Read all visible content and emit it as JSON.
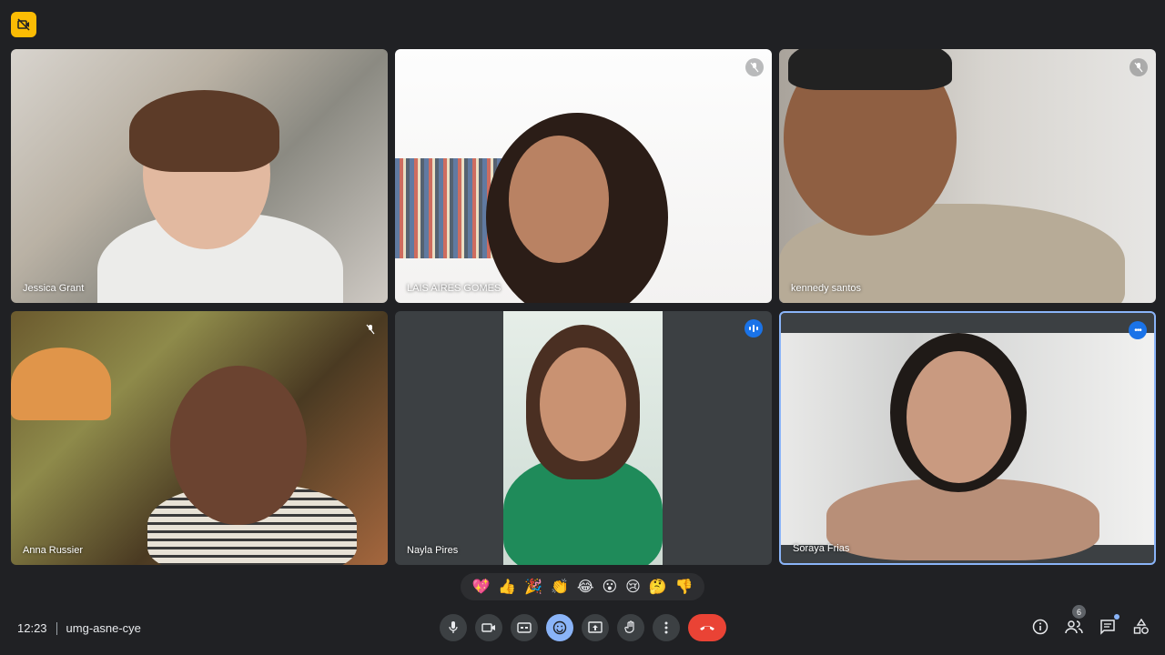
{
  "meeting": {
    "time": "12:23",
    "code": "umg-asne-cye"
  },
  "participants": [
    {
      "name": "Jessica Grant",
      "muted": false
    },
    {
      "name": "LAIS AIRES GOMES",
      "muted": true
    },
    {
      "name": "kennedy santos",
      "muted": true
    },
    {
      "name": "Anna Russier",
      "muted": true
    },
    {
      "name": "Nayla Pires",
      "muted": false,
      "speaking": true
    },
    {
      "name": "Soraya Frias",
      "muted": false,
      "pinned": true
    }
  ],
  "reactions": [
    "💖",
    "👍",
    "🎉",
    "👏",
    "😂",
    "😮",
    "😢",
    "🤔",
    "👎"
  ],
  "people_count": "6",
  "colors": {
    "background": "#202124",
    "control": "#3c4043",
    "accent": "#8ab4f8",
    "leave": "#ea4335",
    "badge": "#fbbc04"
  }
}
